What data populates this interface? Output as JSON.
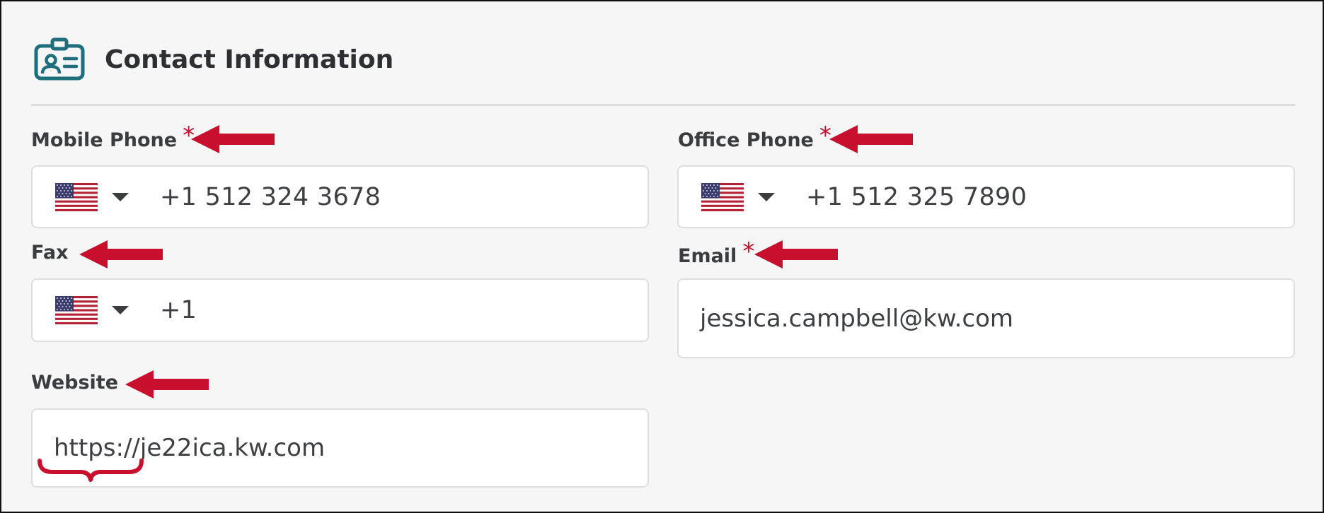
{
  "section": {
    "title": "Contact Information",
    "icon": "contact-card-icon"
  },
  "colors": {
    "annotation": "#c8102e",
    "icon": "#1f6e7e",
    "label": "#3a3c40"
  },
  "fields": {
    "mobile_phone": {
      "label": "Mobile Phone",
      "required_mark": "*",
      "country_flag": "us-flag-icon",
      "value": "+1 512 324 3678"
    },
    "office_phone": {
      "label": "Office Phone",
      "required_mark": "*",
      "country_flag": "us-flag-icon",
      "value": "+1 512 325 7890"
    },
    "fax": {
      "label": "Fax",
      "country_flag": "us-flag-icon",
      "value": "+1"
    },
    "email": {
      "label": "Email",
      "required_mark": "*",
      "value": "jessica.campbell@kw.com"
    },
    "website": {
      "label": "Website",
      "value": "https://je22ica.kw.com"
    }
  }
}
